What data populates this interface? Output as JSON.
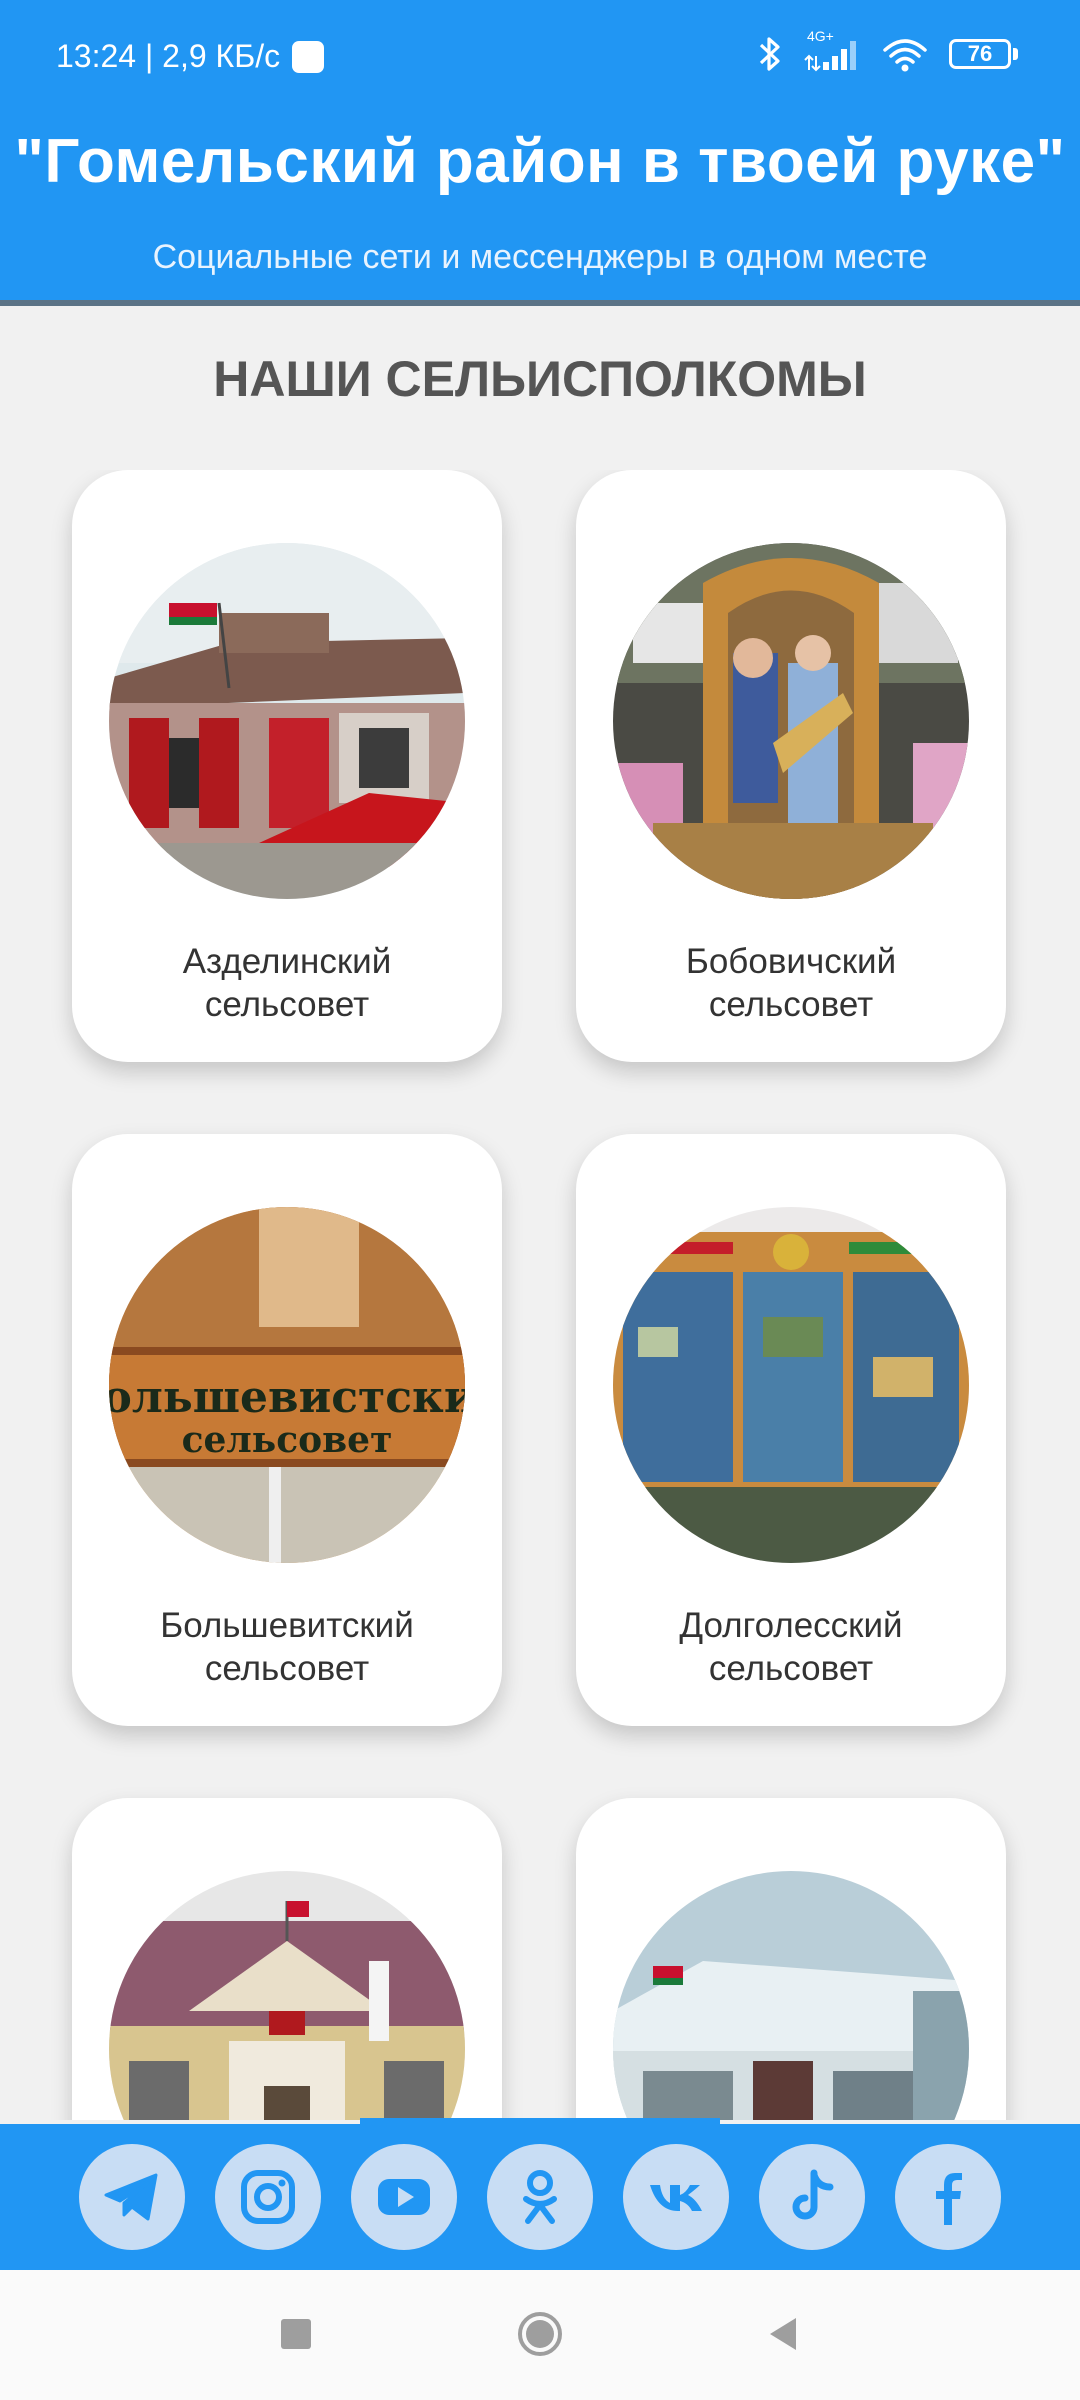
{
  "status_bar": {
    "time_speed": "13:24 | 2,9 КБ/с",
    "network_type": "4G+",
    "battery": "76",
    "icons": [
      "bluetooth-icon",
      "signal-icon",
      "wifi-icon",
      "battery-icon"
    ]
  },
  "header": {
    "title": "\"Гомельский район в твоей руке\"",
    "subtitle": "Социальные сети и мессенджеры в одном месте",
    "background_color": "#2196f3"
  },
  "section": {
    "title": "НАШИ СЕЛЬИСПОЛКОМЫ"
  },
  "cards": [
    {
      "label": "Азделинский сельсовет"
    },
    {
      "label": "Бобовичский сельсовет"
    },
    {
      "label": "Большевитский сельсовет"
    },
    {
      "label": "Долголесский сельсовет"
    },
    {
      "label": ""
    },
    {
      "label": ""
    }
  ],
  "card_photo_signs": {
    "bolshevitsky_line1": "Большевистский",
    "bolshevitsky_line2": "сельсовет"
  },
  "social_links": [
    {
      "name": "Telegram",
      "icon": "telegram-icon"
    },
    {
      "name": "Instagram",
      "icon": "instagram-icon"
    },
    {
      "name": "YouTube",
      "icon": "youtube-icon"
    },
    {
      "name": "Одноклассники",
      "icon": "odnoklassniki-icon"
    },
    {
      "name": "VK",
      "icon": "vk-icon"
    },
    {
      "name": "TikTok",
      "icon": "tiktok-icon"
    },
    {
      "name": "Facebook",
      "icon": "facebook-icon"
    }
  ],
  "nav_bar": {
    "buttons": [
      "recents-button",
      "home-button",
      "back-button"
    ]
  }
}
